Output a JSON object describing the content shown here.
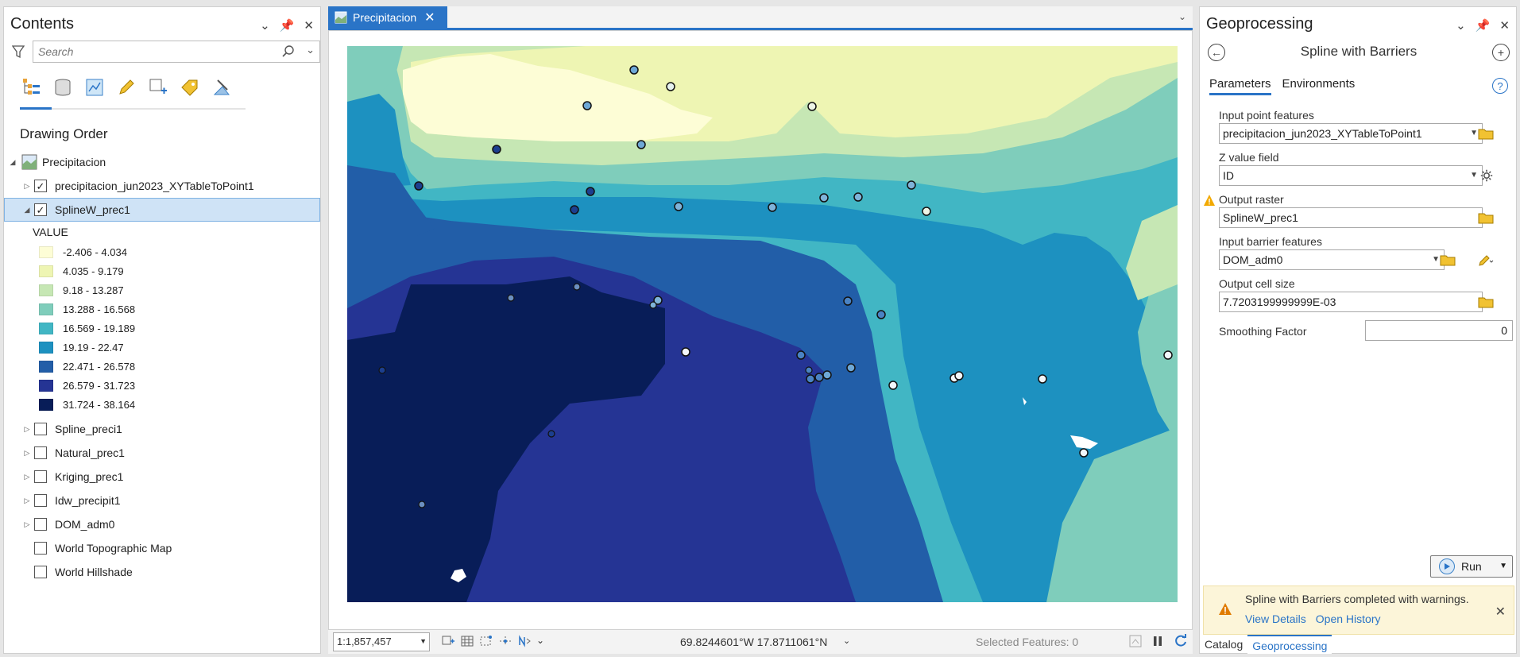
{
  "contents": {
    "title": "Contents",
    "search_placeholder": "Search",
    "section": "Drawing Order",
    "map_name": "Precipitacion",
    "layers_top": [
      {
        "label": "precipitacion_jun2023_XYTableToPoint1",
        "checked": true
      },
      {
        "label": "SplineW_prec1",
        "checked": true
      }
    ],
    "legend_title": "VALUE",
    "legend": [
      {
        "label": "-2.406 - 4.034",
        "color": "#fdfdd6"
      },
      {
        "label": "4.035 - 9.179",
        "color": "#eef5b3"
      },
      {
        "label": "9.18 - 13.287",
        "color": "#c6e7b4"
      },
      {
        "label": "13.288 - 16.568",
        "color": "#7fcdbb"
      },
      {
        "label": "16.569 - 19.189",
        "color": "#41b6c4"
      },
      {
        "label": "19.19 - 22.47",
        "color": "#1d91c0"
      },
      {
        "label": "22.471 - 26.578",
        "color": "#225ea8"
      },
      {
        "label": "26.579 - 31.723",
        "color": "#253494"
      },
      {
        "label": "31.724 - 38.164",
        "color": "#081d58"
      }
    ],
    "layers_bottom": [
      {
        "label": "Spline_preci1",
        "checked": false,
        "expandable": true
      },
      {
        "label": "Natural_prec1",
        "checked": false,
        "expandable": true
      },
      {
        "label": "Kriging_prec1",
        "checked": false,
        "expandable": true
      },
      {
        "label": "Idw_precipit1",
        "checked": false,
        "expandable": true
      },
      {
        "label": "DOM_adm0",
        "checked": false,
        "expandable": true
      },
      {
        "label": "World Topographic Map",
        "checked": false,
        "expandable": false
      },
      {
        "label": "World Hillshade",
        "checked": false,
        "expandable": false
      }
    ]
  },
  "map": {
    "tab_label": "Precipitacion",
    "scale": "1:1,857,457",
    "coords": "69.8244601°W 17.8711061°N",
    "selected_features": "Selected Features: 0"
  },
  "geo": {
    "title": "Geoprocessing",
    "tool_name": "Spline with Barriers",
    "tab_parameters": "Parameters",
    "tab_environments": "Environments",
    "params": {
      "input_points_label": "Input point features",
      "input_points_value": "precipitacion_jun2023_XYTableToPoint1",
      "z_field_label": "Z value field",
      "z_field_value": "ID",
      "output_raster_label": "Output raster",
      "output_raster_value": "SplineW_prec1",
      "barrier_label": "Input barrier features",
      "barrier_value": "DOM_adm0",
      "cell_size_label": "Output cell size",
      "cell_size_value": "7.7203199999999E-03",
      "smoothing_label": "Smoothing Factor",
      "smoothing_value": "0"
    },
    "run_label": "Run",
    "notice_message": "Spline with Barriers completed with warnings.",
    "notice_link_details": "View Details",
    "notice_link_history": "Open History",
    "bottom_tab_catalog": "Catalog",
    "bottom_tab_geoprocessing": "Geoprocessing"
  },
  "colors": {
    "accent": "#2a74c7",
    "selection": "#cfe3f6",
    "warning_bg": "#fcf5d9"
  }
}
